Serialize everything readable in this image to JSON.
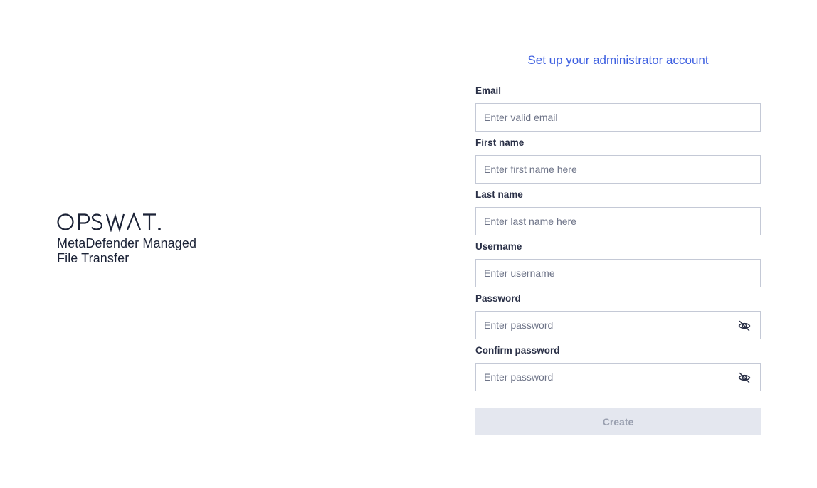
{
  "brand": {
    "logo_text": "OPSWAT.",
    "product_line1": "MetaDefender Managed",
    "product_line2": "File Transfer"
  },
  "form": {
    "title": "Set up your administrator account",
    "fields": [
      {
        "label": "Email",
        "placeholder": "Enter valid email",
        "value": ""
      },
      {
        "label": "First name",
        "placeholder": "Enter first name here",
        "value": ""
      },
      {
        "label": "Last name",
        "placeholder": "Enter last name here",
        "value": ""
      },
      {
        "label": "Username",
        "placeholder": "Enter username",
        "value": ""
      },
      {
        "label": "Password",
        "placeholder": "Enter password",
        "value": "",
        "icon": "eye-off-icon"
      },
      {
        "label": "Confirm password",
        "placeholder": "Enter password",
        "value": "",
        "icon": "eye-off-icon"
      }
    ],
    "submit_label": "Create",
    "submit_disabled": true
  },
  "colors": {
    "accent": "#3d5fe0",
    "text": "#2a3047",
    "border": "#c4c9d6",
    "button_disabled_bg": "#e4e7ef",
    "button_disabled_text": "#9aa0b0"
  }
}
